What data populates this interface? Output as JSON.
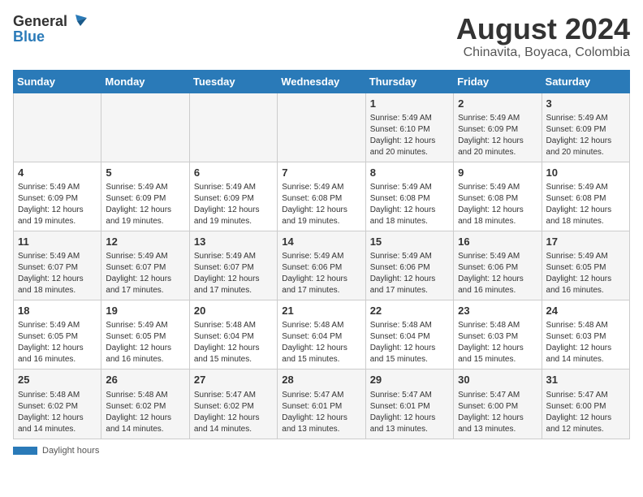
{
  "header": {
    "logo_general": "General",
    "logo_blue": "Blue",
    "month_year": "August 2024",
    "location": "Chinavita, Boyaca, Colombia"
  },
  "footer": {
    "daylight_label": "Daylight hours"
  },
  "days_of_week": [
    "Sunday",
    "Monday",
    "Tuesday",
    "Wednesday",
    "Thursday",
    "Friday",
    "Saturday"
  ],
  "weeks": [
    {
      "days": [
        {
          "num": "",
          "info": ""
        },
        {
          "num": "",
          "info": ""
        },
        {
          "num": "",
          "info": ""
        },
        {
          "num": "",
          "info": ""
        },
        {
          "num": "1",
          "info": "Sunrise: 5:49 AM\nSunset: 6:10 PM\nDaylight: 12 hours\nand 20 minutes."
        },
        {
          "num": "2",
          "info": "Sunrise: 5:49 AM\nSunset: 6:09 PM\nDaylight: 12 hours\nand 20 minutes."
        },
        {
          "num": "3",
          "info": "Sunrise: 5:49 AM\nSunset: 6:09 PM\nDaylight: 12 hours\nand 20 minutes."
        }
      ]
    },
    {
      "days": [
        {
          "num": "4",
          "info": "Sunrise: 5:49 AM\nSunset: 6:09 PM\nDaylight: 12 hours\nand 19 minutes."
        },
        {
          "num": "5",
          "info": "Sunrise: 5:49 AM\nSunset: 6:09 PM\nDaylight: 12 hours\nand 19 minutes."
        },
        {
          "num": "6",
          "info": "Sunrise: 5:49 AM\nSunset: 6:09 PM\nDaylight: 12 hours\nand 19 minutes."
        },
        {
          "num": "7",
          "info": "Sunrise: 5:49 AM\nSunset: 6:08 PM\nDaylight: 12 hours\nand 19 minutes."
        },
        {
          "num": "8",
          "info": "Sunrise: 5:49 AM\nSunset: 6:08 PM\nDaylight: 12 hours\nand 18 minutes."
        },
        {
          "num": "9",
          "info": "Sunrise: 5:49 AM\nSunset: 6:08 PM\nDaylight: 12 hours\nand 18 minutes."
        },
        {
          "num": "10",
          "info": "Sunrise: 5:49 AM\nSunset: 6:08 PM\nDaylight: 12 hours\nand 18 minutes."
        }
      ]
    },
    {
      "days": [
        {
          "num": "11",
          "info": "Sunrise: 5:49 AM\nSunset: 6:07 PM\nDaylight: 12 hours\nand 18 minutes."
        },
        {
          "num": "12",
          "info": "Sunrise: 5:49 AM\nSunset: 6:07 PM\nDaylight: 12 hours\nand 17 minutes."
        },
        {
          "num": "13",
          "info": "Sunrise: 5:49 AM\nSunset: 6:07 PM\nDaylight: 12 hours\nand 17 minutes."
        },
        {
          "num": "14",
          "info": "Sunrise: 5:49 AM\nSunset: 6:06 PM\nDaylight: 12 hours\nand 17 minutes."
        },
        {
          "num": "15",
          "info": "Sunrise: 5:49 AM\nSunset: 6:06 PM\nDaylight: 12 hours\nand 17 minutes."
        },
        {
          "num": "16",
          "info": "Sunrise: 5:49 AM\nSunset: 6:06 PM\nDaylight: 12 hours\nand 16 minutes."
        },
        {
          "num": "17",
          "info": "Sunrise: 5:49 AM\nSunset: 6:05 PM\nDaylight: 12 hours\nand 16 minutes."
        }
      ]
    },
    {
      "days": [
        {
          "num": "18",
          "info": "Sunrise: 5:49 AM\nSunset: 6:05 PM\nDaylight: 12 hours\nand 16 minutes."
        },
        {
          "num": "19",
          "info": "Sunrise: 5:49 AM\nSunset: 6:05 PM\nDaylight: 12 hours\nand 16 minutes."
        },
        {
          "num": "20",
          "info": "Sunrise: 5:48 AM\nSunset: 6:04 PM\nDaylight: 12 hours\nand 15 minutes."
        },
        {
          "num": "21",
          "info": "Sunrise: 5:48 AM\nSunset: 6:04 PM\nDaylight: 12 hours\nand 15 minutes."
        },
        {
          "num": "22",
          "info": "Sunrise: 5:48 AM\nSunset: 6:04 PM\nDaylight: 12 hours\nand 15 minutes."
        },
        {
          "num": "23",
          "info": "Sunrise: 5:48 AM\nSunset: 6:03 PM\nDaylight: 12 hours\nand 15 minutes."
        },
        {
          "num": "24",
          "info": "Sunrise: 5:48 AM\nSunset: 6:03 PM\nDaylight: 12 hours\nand 14 minutes."
        }
      ]
    },
    {
      "days": [
        {
          "num": "25",
          "info": "Sunrise: 5:48 AM\nSunset: 6:02 PM\nDaylight: 12 hours\nand 14 minutes."
        },
        {
          "num": "26",
          "info": "Sunrise: 5:48 AM\nSunset: 6:02 PM\nDaylight: 12 hours\nand 14 minutes."
        },
        {
          "num": "27",
          "info": "Sunrise: 5:47 AM\nSunset: 6:02 PM\nDaylight: 12 hours\nand 14 minutes."
        },
        {
          "num": "28",
          "info": "Sunrise: 5:47 AM\nSunset: 6:01 PM\nDaylight: 12 hours\nand 13 minutes."
        },
        {
          "num": "29",
          "info": "Sunrise: 5:47 AM\nSunset: 6:01 PM\nDaylight: 12 hours\nand 13 minutes."
        },
        {
          "num": "30",
          "info": "Sunrise: 5:47 AM\nSunset: 6:00 PM\nDaylight: 12 hours\nand 13 minutes."
        },
        {
          "num": "31",
          "info": "Sunrise: 5:47 AM\nSunset: 6:00 PM\nDaylight: 12 hours\nand 12 minutes."
        }
      ]
    }
  ]
}
